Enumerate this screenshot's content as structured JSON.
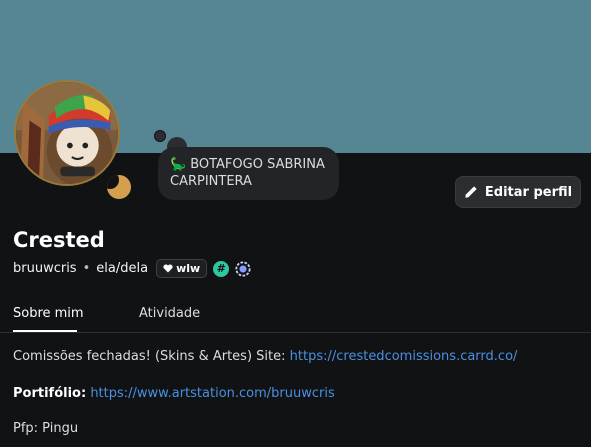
{
  "profile": {
    "display_name": "Crested",
    "username": "bruuwcris",
    "separator": "•",
    "pronouns": "ela/dela",
    "tag_label": "wlw",
    "badges": [
      "hash-badge",
      "nitro-badge"
    ]
  },
  "custom_status": {
    "emoji": "dinosaur-icon",
    "text": "BOTAFOGO SABRINA CARPINTERA"
  },
  "actions": {
    "edit_label": "Editar perfil"
  },
  "tabs": [
    {
      "label": "Sobre mim",
      "active": true
    },
    {
      "label": "Atividade",
      "active": false
    }
  ],
  "bio": {
    "line1_text": "Comissões fechadas! (Skins & Artes) Site: ",
    "line1_link": "https://crestedcomissions.carrd.co/",
    "line2_label": "Portifólio:",
    "line2_link": "https://www.artstation.com/bruuwcris",
    "line3_text": "Pfp: Pingu"
  },
  "colors": {
    "banner": "#568593",
    "background": "#111214",
    "link": "#4a90e2",
    "avatar_ring": "#9b7a3c",
    "status_idle": "#d4a050"
  }
}
